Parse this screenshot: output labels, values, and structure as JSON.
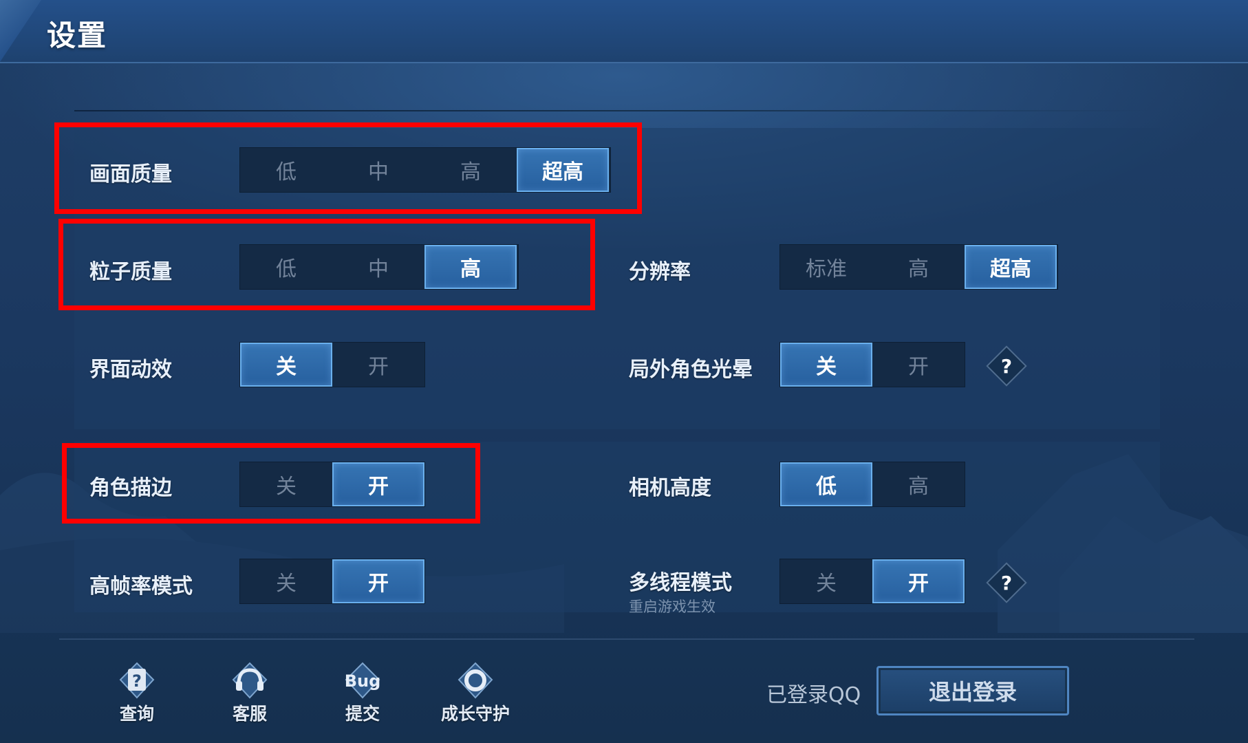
{
  "header": {
    "title": "设置"
  },
  "settings": [
    {
      "label": "画面质量",
      "options": [
        "低",
        "中",
        "高",
        "超高"
      ],
      "selected": "超高"
    },
    {
      "label": "粒子质量",
      "options": [
        "低",
        "中",
        "高"
      ],
      "selected": "高"
    },
    {
      "label": "界面动效",
      "options": [
        "关",
        "开"
      ],
      "selected": "关"
    },
    {
      "label": "角色描边",
      "options": [
        "关",
        "开"
      ],
      "selected": "开"
    },
    {
      "label": "高帧率模式",
      "options": [
        "关",
        "开"
      ],
      "selected": "开"
    },
    {
      "label": "分辨率",
      "options": [
        "标准",
        "高",
        "超高"
      ],
      "selected": "超高"
    },
    {
      "label": "局外角色光晕",
      "options": [
        "关",
        "开"
      ],
      "selected": "关",
      "help": "?"
    },
    {
      "label": "相机高度",
      "options": [
        "低",
        "高"
      ],
      "selected": "低"
    },
    {
      "label": "多线程模式",
      "sublabel": "重启游戏生效",
      "options": [
        "关",
        "开"
      ],
      "selected": "开",
      "help": "?"
    }
  ],
  "toolbar": {
    "items": [
      {
        "label": "查询",
        "icon": "question-book-icon"
      },
      {
        "label": "客服",
        "icon": "headset-icon"
      },
      {
        "label": "提交",
        "icon": "bug-icon",
        "icon_text": "Bug"
      },
      {
        "label": "成长守护",
        "icon": "shield-ring-icon"
      }
    ]
  },
  "account": {
    "status": "已登录QQ",
    "logout_label": "退出登录"
  },
  "colors": {
    "highlight": "#ff0000",
    "selected": "#2f6aaa",
    "background": "#1b3860"
  }
}
